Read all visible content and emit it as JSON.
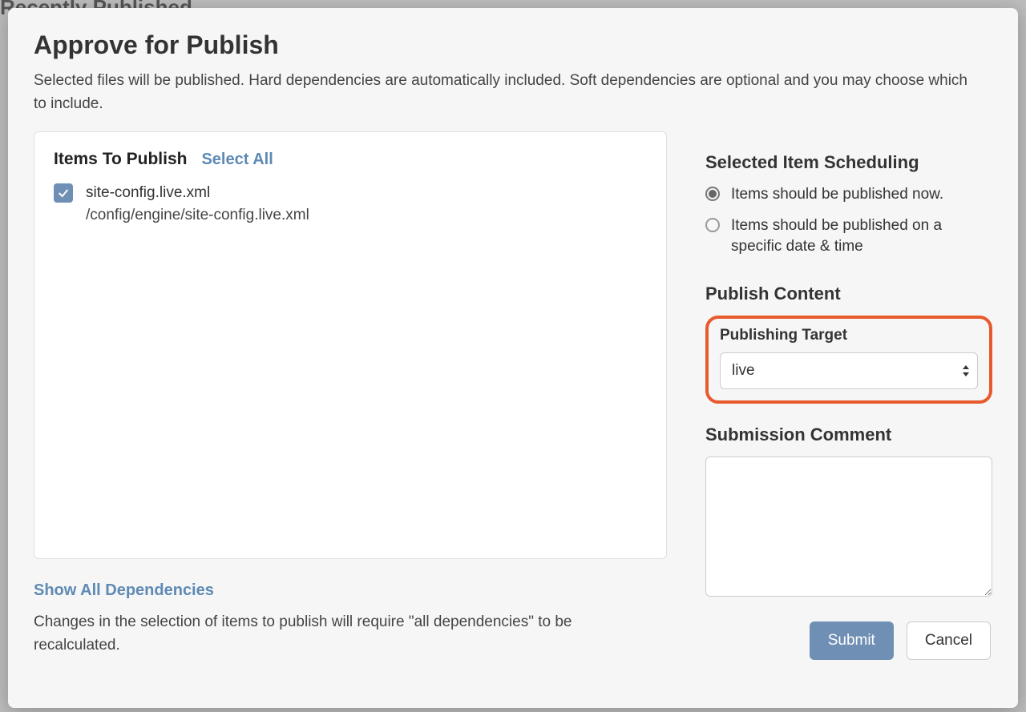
{
  "background": {
    "title": "Recently Published"
  },
  "modal": {
    "title": "Approve for Publish",
    "subtitle": "Selected files will be published. Hard dependencies are automatically included. Soft dependencies are optional and you may choose which to include."
  },
  "items": {
    "heading": "Items To Publish",
    "select_all": "Select All",
    "list": [
      {
        "name": "site-config.live.xml",
        "path": "/config/engine/site-config.live.xml",
        "checked": true
      }
    ]
  },
  "dependencies": {
    "link": "Show All Dependencies",
    "note": "Changes in the selection of items to publish will require \"all dependencies\" to be recalculated."
  },
  "scheduling": {
    "heading": "Selected Item Scheduling",
    "options": [
      {
        "label": "Items should be published now.",
        "selected": true
      },
      {
        "label": "Items should be published on a specific date & time",
        "selected": false
      }
    ]
  },
  "publish_content": {
    "heading": "Publish Content",
    "target_label": "Publishing Target",
    "target_value": "live"
  },
  "comment": {
    "heading": "Submission Comment",
    "value": ""
  },
  "buttons": {
    "submit": "Submit",
    "cancel": "Cancel"
  }
}
